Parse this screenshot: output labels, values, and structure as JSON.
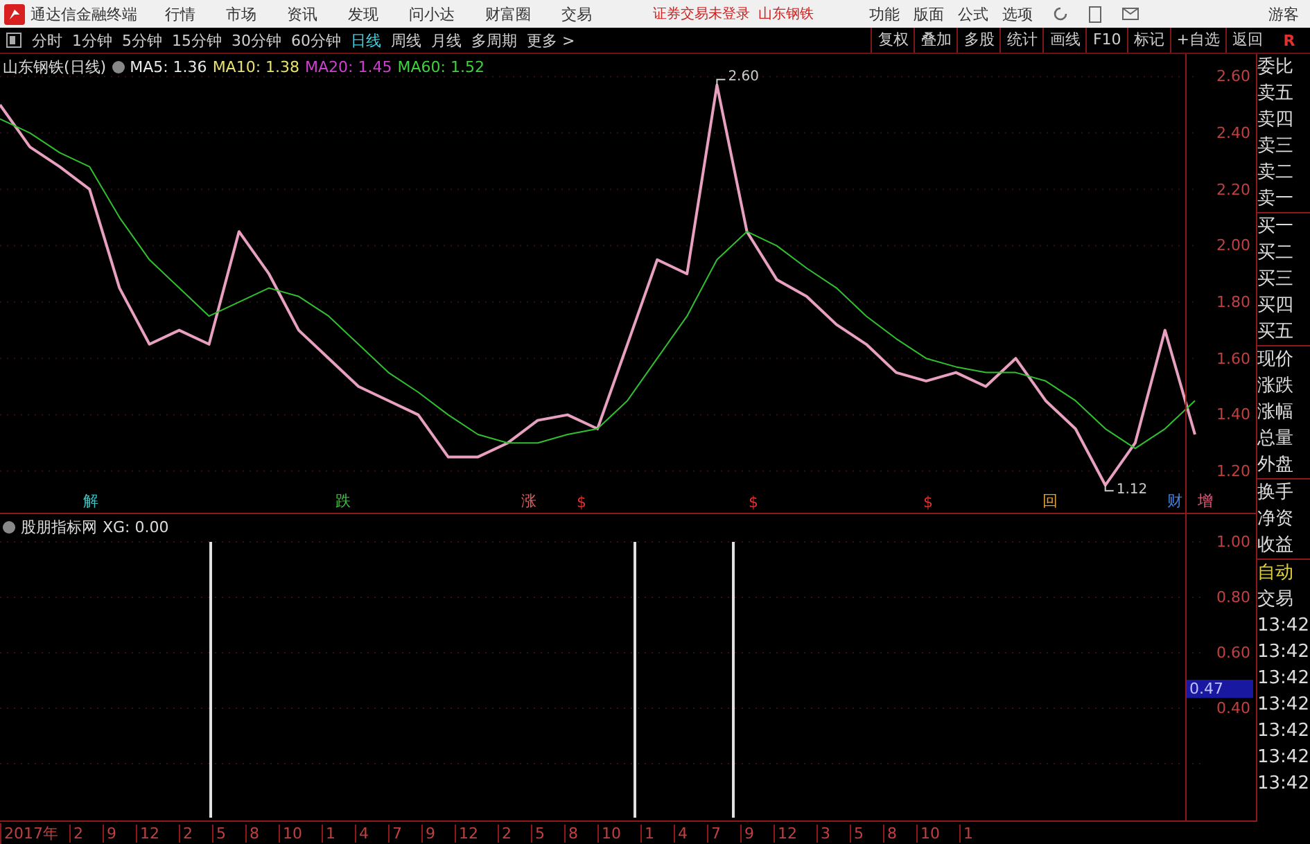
{
  "app": {
    "title": "通达信金融终端"
  },
  "menu": [
    "行情",
    "市场",
    "资讯",
    "发现",
    "问小达",
    "财富圈",
    "交易"
  ],
  "status": [
    "证券交易未登录",
    "山东钢铁"
  ],
  "right_menu": [
    "功能",
    "版面",
    "公式",
    "选项"
  ],
  "user": "游客",
  "periods": [
    {
      "label": "分时",
      "selected": false
    },
    {
      "label": "1分钟",
      "selected": false
    },
    {
      "label": "5分钟",
      "selected": false
    },
    {
      "label": "15分钟",
      "selected": false
    },
    {
      "label": "30分钟",
      "selected": false
    },
    {
      "label": "60分钟",
      "selected": false
    },
    {
      "label": "日线",
      "selected": true
    },
    {
      "label": "周线",
      "selected": false
    },
    {
      "label": "月线",
      "selected": false
    },
    {
      "label": "多周期",
      "selected": false
    },
    {
      "label": "更多 >",
      "selected": false
    }
  ],
  "tools": [
    "复权",
    "叠加",
    "多股",
    "统计",
    "画线",
    "F10",
    "标记",
    "+自选",
    "返回"
  ],
  "corner": "R",
  "legend": {
    "title": "山东钢铁(日线)",
    "ma": [
      {
        "label": "MA5: 1.36",
        "color": "#e8e8e8"
      },
      {
        "label": "MA10: 1.38",
        "color": "#e8e070"
      },
      {
        "label": "MA20: 1.45",
        "color": "#d040d0"
      },
      {
        "label": "MA60: 1.52",
        "color": "#40d040"
      }
    ]
  },
  "price_chart": {
    "chart_data": {
      "type": "line",
      "ylim": [
        -0.03,
        2.68
      ],
      "grid": true,
      "yticks": [
        {
          "value": 2.6,
          "label": "2.60"
        },
        {
          "value": 2.4,
          "label": "2.40"
        },
        {
          "value": 2.2,
          "label": "2.20"
        },
        {
          "value": 2.0,
          "label": "2.00"
        },
        {
          "value": 1.8,
          "label": "1.80"
        },
        {
          "value": 1.6,
          "label": "1.60"
        },
        {
          "value": 1.4,
          "label": "1.40"
        },
        {
          "value": 1.2,
          "label": "1.20"
        }
      ],
      "series": [
        {
          "color": "#e8a0c0",
          "values": [
            2.5,
            2.35,
            2.28,
            2.2,
            1.85,
            1.65,
            1.7,
            1.65,
            2.05,
            1.9,
            1.7,
            1.6,
            1.5,
            1.45,
            1.4,
            1.25,
            1.25,
            1.3,
            1.38,
            1.4,
            1.35,
            1.65,
            1.95,
            1.9,
            2.57,
            2.05,
            1.88,
            1.82,
            1.72,
            1.65,
            1.55,
            1.52,
            1.55,
            1.5,
            1.6,
            1.45,
            1.35,
            1.15,
            1.3,
            1.7,
            1.33
          ]
        },
        {
          "color": "#30c030",
          "values": [
            2.45,
            2.4,
            2.33,
            2.28,
            2.1,
            1.95,
            1.85,
            1.75,
            1.8,
            1.85,
            1.82,
            1.75,
            1.65,
            1.55,
            1.48,
            1.4,
            1.33,
            1.3,
            1.3,
            1.33,
            1.35,
            1.45,
            1.6,
            1.75,
            1.95,
            2.05,
            2.0,
            1.92,
            1.85,
            1.75,
            1.67,
            1.6,
            1.57,
            1.55,
            1.55,
            1.52,
            1.45,
            1.35,
            1.28,
            1.35,
            1.45
          ]
        }
      ]
    }
  },
  "high_label": "2.60",
  "low_label": "1.12",
  "events": [
    {
      "label": "解",
      "color": "#40c0c0"
    },
    {
      "label": "跌",
      "color": "#40c040"
    },
    {
      "label": "涨",
      "color": "#e06060"
    },
    {
      "label": "$",
      "color": "#e03030"
    },
    {
      "label": "$",
      "color": "#e03030"
    },
    {
      "label": "$",
      "color": "#e03030"
    },
    {
      "label": "回",
      "color": "#e0a040"
    },
    {
      "label": "财",
      "color": "#4080e0"
    },
    {
      "label": "增",
      "color": "#e06080"
    }
  ],
  "indicator": {
    "title": "股朋指标网",
    "value": "XG: 0.00",
    "axis": [
      "1.00",
      "0.80",
      "0.60",
      "0.40"
    ],
    "current": "0.47"
  },
  "quote_fields": [
    "委比",
    "卖五",
    "卖四",
    "卖三",
    "卖二",
    "卖一",
    "买一",
    "买二",
    "买三",
    "买四",
    "买五",
    "现价",
    "涨跌",
    "涨幅",
    "总量",
    "外盘",
    "换手",
    "净资",
    "收益"
  ],
  "trade": [
    "自动",
    "交易"
  ],
  "times": [
    "13:42",
    "13:42",
    "13:42",
    "13:42",
    "13:42",
    "13:42",
    "13:42"
  ],
  "time_axis": [
    "2017年",
    "2",
    "9",
    "12",
    "2",
    "5",
    "8",
    "10",
    "1",
    "4",
    "7",
    "9",
    "12",
    "2",
    "5",
    "8",
    "10",
    "1",
    "4",
    "7",
    "9",
    "12",
    "3",
    "5",
    "8",
    "10",
    "1"
  ]
}
